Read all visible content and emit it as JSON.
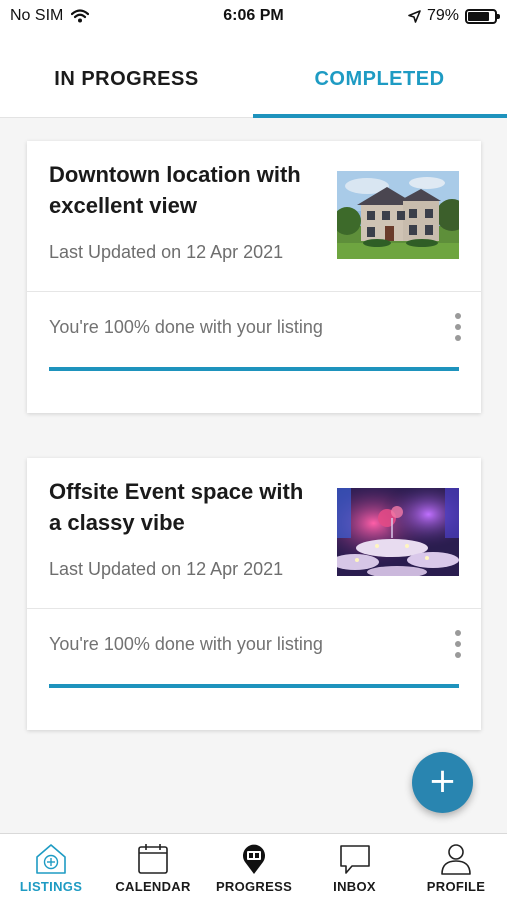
{
  "status_bar": {
    "carrier": "No SIM",
    "time": "6:06 PM",
    "battery": "79%",
    "battery_level": 0.79
  },
  "tabs": [
    {
      "label": "IN PROGRESS",
      "active": false
    },
    {
      "label": "COMPLETED",
      "active": true
    }
  ],
  "listings": [
    {
      "title": "Downtown location with excellent view",
      "updated": "Last Updated on 12 Apr 2021",
      "progress_text": "You're 100% done with your listing",
      "progress": 1.0,
      "image": "house-photo"
    },
    {
      "title": "Offsite Event space with a classy vibe",
      "updated": "Last Updated on 12 Apr 2021",
      "progress_text": "You're 100% done with your listing",
      "progress": 1.0,
      "image": "event-hall-photo"
    }
  ],
  "fab": {
    "icon": "plus-icon",
    "symbol": "+"
  },
  "bottom_nav": [
    {
      "label": "LISTINGS",
      "icon": "home-plus-icon",
      "active": true
    },
    {
      "label": "CALENDAR",
      "icon": "calendar-icon",
      "active": false
    },
    {
      "label": "PROGRESS",
      "icon": "progress-pin-icon",
      "active": false
    },
    {
      "label": "INBOX",
      "icon": "chat-bubble-icon",
      "active": false
    },
    {
      "label": "PROFILE",
      "icon": "person-icon",
      "active": false
    }
  ],
  "colors": {
    "accent": "#1e93bd",
    "fab": "#2985b0",
    "active_label": "#1e9bc3"
  }
}
